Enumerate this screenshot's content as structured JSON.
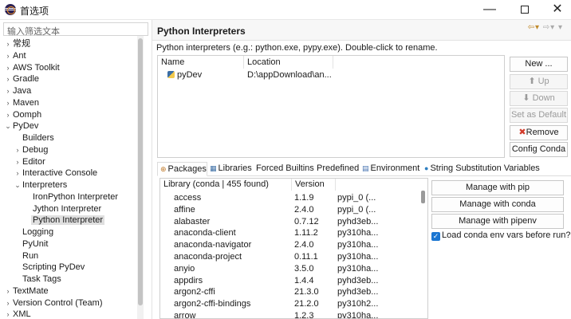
{
  "window": {
    "title": "首选项"
  },
  "filter": {
    "placeholder": "输入筛选文本"
  },
  "tree": [
    {
      "label": "常规",
      "arrow": "›",
      "x": 10,
      "y": 0
    },
    {
      "label": "Ant",
      "arrow": "›",
      "x": 10,
      "y": 1
    },
    {
      "label": "AWS Toolkit",
      "arrow": "›",
      "x": 10,
      "y": 2
    },
    {
      "label": "Gradle",
      "arrow": "›",
      "x": 10,
      "y": 3
    },
    {
      "label": "Java",
      "arrow": "›",
      "x": 10,
      "y": 4
    },
    {
      "label": "Maven",
      "arrow": "›",
      "x": 10,
      "y": 5
    },
    {
      "label": "Oomph",
      "arrow": "›",
      "x": 10,
      "y": 6
    },
    {
      "label": "PyDev",
      "arrow": "⌄",
      "x": 10,
      "y": 7
    },
    {
      "label": "Builders",
      "arrow": "",
      "x": 22,
      "y": 8
    },
    {
      "label": "Debug",
      "arrow": "›",
      "x": 22,
      "y": 9
    },
    {
      "label": "Editor",
      "arrow": "›",
      "x": 22,
      "y": 10
    },
    {
      "label": "Interactive Console",
      "arrow": "›",
      "x": 22,
      "y": 11
    },
    {
      "label": "Interpreters",
      "arrow": "⌄",
      "x": 22,
      "y": 12
    },
    {
      "label": "IronPython Interpreter",
      "arrow": "",
      "x": 35,
      "y": 13
    },
    {
      "label": "Jython Interpreter",
      "arrow": "",
      "x": 35,
      "y": 14
    },
    {
      "label": "Python Interpreter",
      "arrow": "",
      "x": 35,
      "y": 15,
      "selected": true
    },
    {
      "label": "Logging",
      "arrow": "",
      "x": 22,
      "y": 16
    },
    {
      "label": "PyUnit",
      "arrow": "",
      "x": 22,
      "y": 17
    },
    {
      "label": "Run",
      "arrow": "",
      "x": 22,
      "y": 18
    },
    {
      "label": "Scripting PyDev",
      "arrow": "",
      "x": 22,
      "y": 19
    },
    {
      "label": "Task Tags",
      "arrow": "",
      "x": 22,
      "y": 20
    },
    {
      "label": "TextMate",
      "arrow": "›",
      "x": 10,
      "y": 21
    },
    {
      "label": "Version Control (Team)",
      "arrow": "›",
      "x": 10,
      "y": 22
    },
    {
      "label": "XML",
      "arrow": "›",
      "x": 10,
      "y": 23
    }
  ],
  "page": {
    "title": "Python Interpreters",
    "description": "Python interpreters (e.g.: python.exe, pypy.exe).   Double-click to rename."
  },
  "interpreters": {
    "col_name": "Name",
    "col_location": "Location",
    "rows": [
      {
        "name": "pyDev",
        "location": "D:\\appDownload\\an..."
      }
    ]
  },
  "buttons": {
    "new": "New ...",
    "up": "Up",
    "down": "Down",
    "set_default": "Set as Default",
    "remove": "Remove",
    "config_conda": "Config Conda"
  },
  "tabs": [
    {
      "label": "Packages",
      "icon": "package-icon",
      "active": true
    },
    {
      "label": "Libraries",
      "icon": "library-icon"
    },
    {
      "label": "Forced Builtins"
    },
    {
      "label": "Predefined"
    },
    {
      "label": "Environment",
      "icon": "environment-icon"
    },
    {
      "label": "String Substitution Variables",
      "icon": "variable-icon"
    }
  ],
  "packages": {
    "col_library": "Library (conda | 455 found)",
    "col_version": "Version",
    "rows": [
      {
        "name": "access",
        "version": "1.1.9",
        "source": "pypi_0 (..."
      },
      {
        "name": "affine",
        "version": "2.4.0",
        "source": "pypi_0 (..."
      },
      {
        "name": "alabaster",
        "version": "0.7.12",
        "source": "pyhd3eb..."
      },
      {
        "name": "anaconda-client",
        "version": "1.11.2",
        "source": "py310ha..."
      },
      {
        "name": "anaconda-navigator",
        "version": "2.4.0",
        "source": "py310ha..."
      },
      {
        "name": "anaconda-project",
        "version": "0.11.1",
        "source": "py310ha..."
      },
      {
        "name": "anyio",
        "version": "3.5.0",
        "source": "py310ha..."
      },
      {
        "name": "appdirs",
        "version": "1.4.4",
        "source": "pyhd3eb..."
      },
      {
        "name": "argon2-cffi",
        "version": "21.3.0",
        "source": "pyhd3eb..."
      },
      {
        "name": "argon2-cffi-bindings",
        "version": "21.2.0",
        "source": "py310h2..."
      },
      {
        "name": "arrow",
        "version": "1.2.3",
        "source": "py310ha..."
      }
    ]
  },
  "pkg_buttons": {
    "pip": "Manage with pip",
    "conda": "Manage with conda",
    "pipenv": "Manage with pipenv"
  },
  "checkbox": {
    "label": "Load conda env vars before run?",
    "checked": true
  }
}
